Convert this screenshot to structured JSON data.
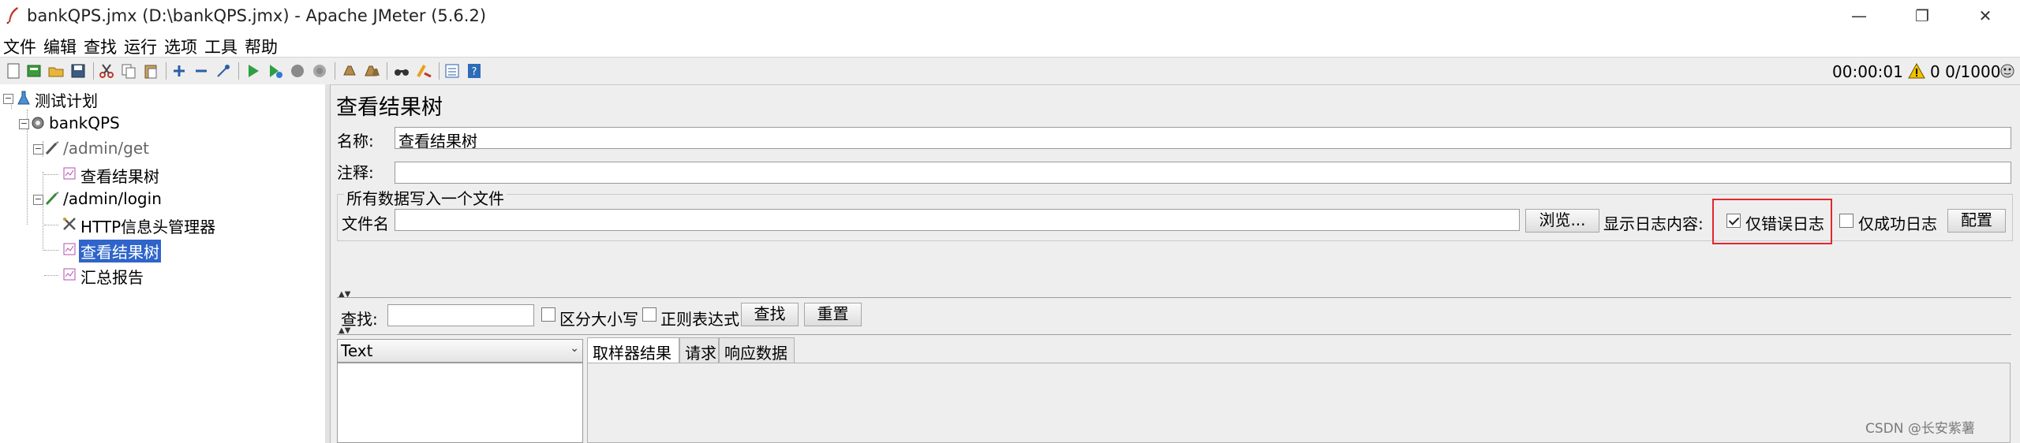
{
  "window": {
    "title": "bankQPS.jmx (D:\\bankQPS.jmx) - Apache JMeter (5.6.2)",
    "minimize": "—",
    "maximize": "❐",
    "close": "✕"
  },
  "menu": [
    "文件",
    "编辑",
    "查找",
    "运行",
    "选项",
    "工具",
    "帮助"
  ],
  "toolbar": {
    "icons": [
      "new-icon",
      "templates-icon",
      "open-icon",
      "save-icon",
      "cut-icon",
      "copy-icon",
      "paste-icon",
      "expand-icon",
      "collapse-icon",
      "toggle-icon",
      "start-icon",
      "start-no-pause-icon",
      "stop-icon",
      "shutdown-icon",
      "clear-icon",
      "clear-all-icon",
      "search-icon",
      "reset-search-icon",
      "function-helper-icon",
      "help-icon"
    ],
    "elapsed": "00:00:01",
    "warnings": "0",
    "threads": "0/1000"
  },
  "tree": [
    {
      "label": "测试计划",
      "icon": "test-plan-icon"
    },
    {
      "label": "bankQPS",
      "icon": "thread-group-icon"
    },
    {
      "label": "/admin/get",
      "icon": "sampler-icon"
    },
    {
      "label": "查看结果树",
      "icon": "listener-icon"
    },
    {
      "label": "/admin/login",
      "icon": "sampler-icon"
    },
    {
      "label": "HTTP信息头管理器",
      "icon": "header-manager-icon"
    },
    {
      "label": "查看结果树",
      "icon": "listener-icon"
    },
    {
      "label": "汇总报告",
      "icon": "listener-icon"
    }
  ],
  "panel": {
    "title": "查看结果树",
    "name_label": "名称:",
    "name_value": "查看结果树",
    "comment_label": "注释:",
    "comment_value": "",
    "file_group_title": "所有数据写入一个文件",
    "filename_label": "文件名",
    "filename_value": "",
    "browse_button": "浏览...",
    "log_content_label": "显示日志内容:",
    "errors_only_label": "仅错误日志",
    "errors_only_checked": true,
    "successes_only_label": "仅成功日志",
    "successes_only_checked": false,
    "configure_button": "配置"
  },
  "search": {
    "label": "查找:",
    "value": "",
    "case_sensitive_label": "区分大小写",
    "regex_label": "正则表达式",
    "find_button": "查找",
    "reset_button": "重置"
  },
  "results": {
    "renderer_selected": "Text",
    "tabs": [
      "取样器结果",
      "请求",
      "响应数据"
    ]
  },
  "watermark": "CSDN @长安紫薯"
}
